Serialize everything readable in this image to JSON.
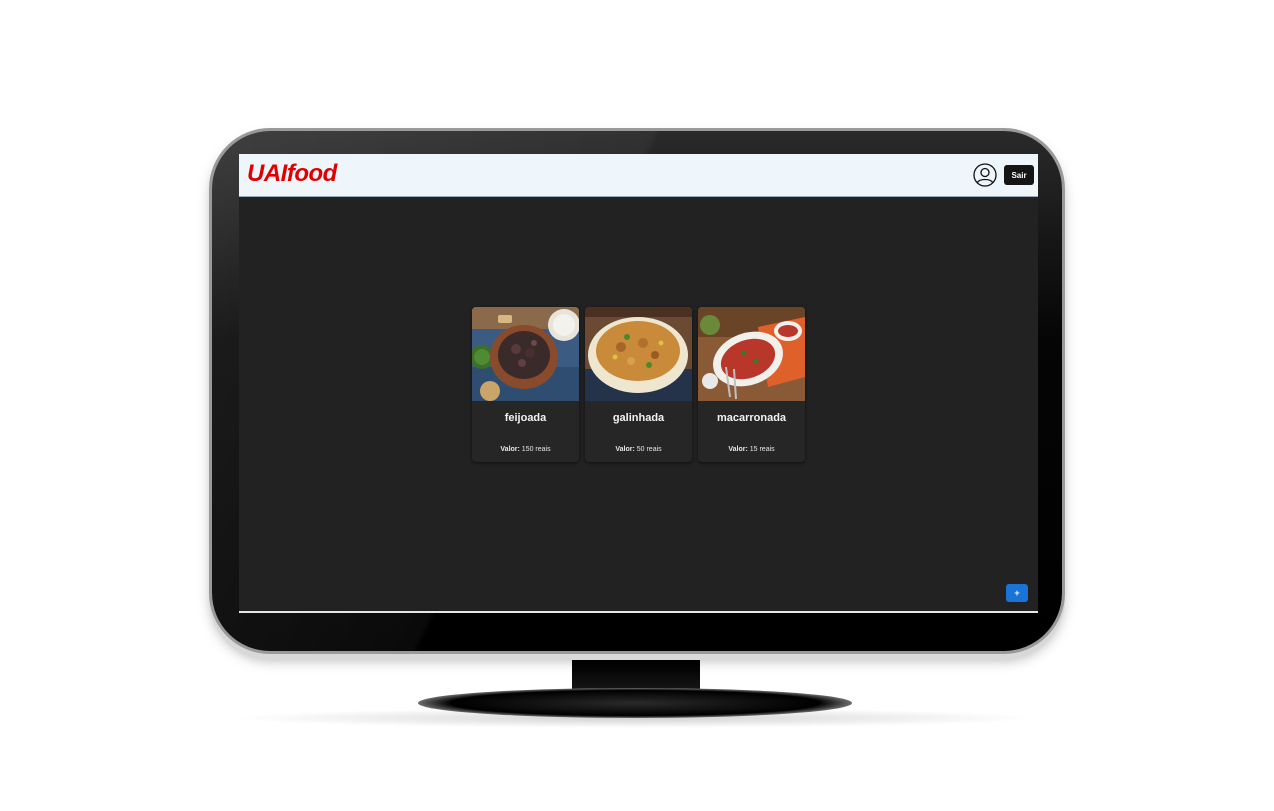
{
  "app": {
    "logo_text": "UAIfood",
    "logo_color": "#e00000"
  },
  "header": {
    "user_icon": "user-circle-icon",
    "logout_label": "Sair"
  },
  "dishes": [
    {
      "name": "feijoada",
      "price_label": "Valor:",
      "price_value": "150 reais",
      "image": "feijoada-photo"
    },
    {
      "name": "galinhada",
      "price_label": "Valor:",
      "price_value": "50 reais",
      "image": "galinhada-photo"
    },
    {
      "name": "macarronada",
      "price_label": "Valor:",
      "price_value": "15 reais",
      "image": "macarronada-photo"
    }
  ],
  "actions": {
    "add_label": "+",
    "add_color": "#1a73d6"
  },
  "colors": {
    "header_bg": "#eef6fc",
    "screen_bg": "#222222",
    "card_bg": "#262626"
  }
}
